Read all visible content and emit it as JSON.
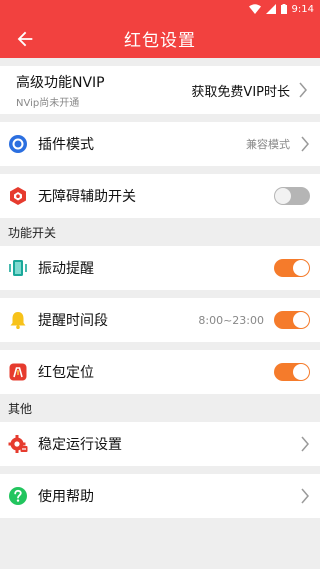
{
  "status": {
    "time": "9:14"
  },
  "header": {
    "title": "红包设置"
  },
  "vip": {
    "title": "高级功能NVIP",
    "subtitle": "NVip尚未开通",
    "action": "获取免费VIP时长"
  },
  "plugin": {
    "label": "插件模式",
    "value": "兼容模式"
  },
  "accessibility": {
    "label": "无障碍辅助开关",
    "enabled": false
  },
  "sections": {
    "features": "功能开关",
    "other": "其他"
  },
  "vibrate": {
    "label": "振动提醒",
    "enabled": true
  },
  "reminder_time": {
    "label": "提醒时间段",
    "value": "8:00~23:00",
    "enabled": true
  },
  "locate": {
    "label": "红包定位",
    "enabled": true
  },
  "stable": {
    "label": "稳定运行设置"
  },
  "help": {
    "label": "使用帮助"
  },
  "colors": {
    "brand": "#f2413f",
    "accent": "#f57b2b",
    "plugin_icon": "#2b6fe0",
    "help_icon": "#22c55e"
  }
}
